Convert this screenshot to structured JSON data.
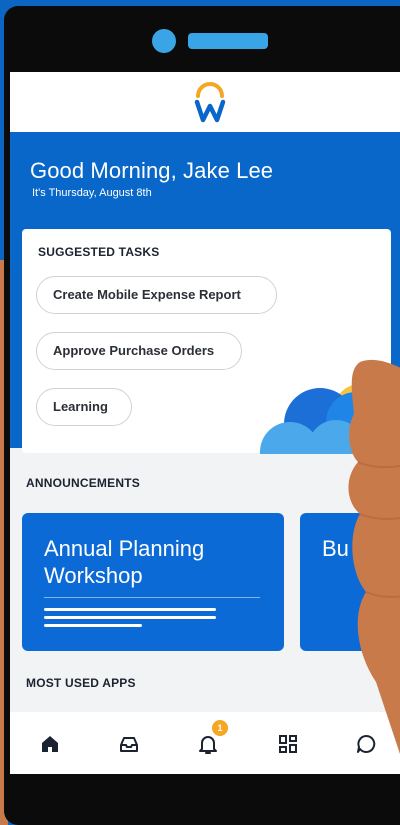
{
  "header": {
    "greeting": "Good Morning, Jake Lee",
    "date": "It's Thursday, August 8th"
  },
  "suggested_tasks": {
    "title": "SUGGESTED TASKS",
    "items": [
      {
        "label": "Create Mobile Expense Report"
      },
      {
        "label": "Approve Purchase Orders"
      },
      {
        "label": "Learning"
      }
    ]
  },
  "announcements": {
    "title": "ANNOUNCEMENTS",
    "cards": [
      {
        "title": "Annual Planning Workshop"
      },
      {
        "title": "Bu Gr"
      }
    ]
  },
  "most_used_apps": {
    "title": "MOST USED APPS"
  },
  "bottom_nav": {
    "items": [
      {
        "icon": "home-icon"
      },
      {
        "icon": "inbox-icon"
      },
      {
        "icon": "bell-icon",
        "badge": "1"
      },
      {
        "icon": "apps-icon"
      },
      {
        "icon": "chat-icon"
      }
    ]
  },
  "colors": {
    "brand_blue": "#0867c9",
    "card_blue": "#0b6ad6",
    "badge_orange": "#f5a623",
    "logo_orange": "#f5a623"
  }
}
